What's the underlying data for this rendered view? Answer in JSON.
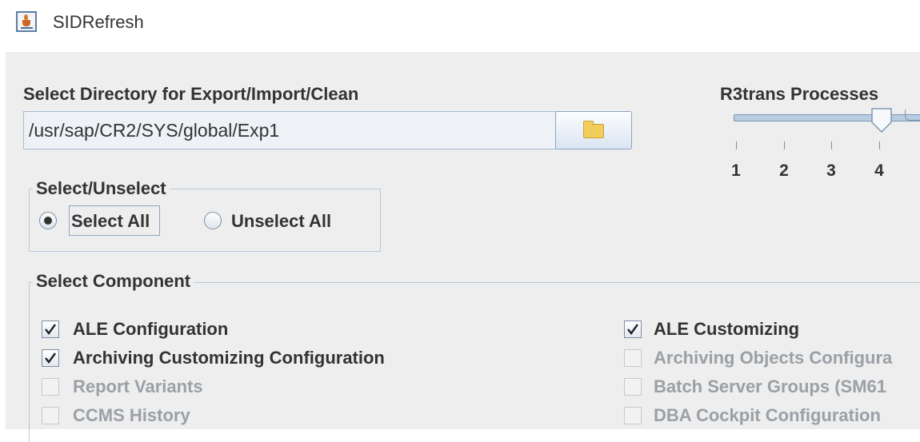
{
  "window": {
    "title": "SIDRefresh",
    "icon": "java-app-icon"
  },
  "directory": {
    "label": "Select Directory for Export/Import/Clean",
    "value": "/usr/sap/CR2/SYS/global/Exp1",
    "browse_icon": "folder-icon"
  },
  "r3trans": {
    "label": "R3trans Processes",
    "ticks": [
      "1",
      "2",
      "3",
      "4"
    ],
    "selected": "4"
  },
  "select_group": {
    "title": "Select/Unselect",
    "select_all": "Select All",
    "unselect_all": "Unselect All",
    "selected": "Select All"
  },
  "components": {
    "title": "Select Component",
    "left": [
      {
        "label": "ALE Configuration",
        "checked": true,
        "enabled": true
      },
      {
        "label": "Archiving Customizing Configuration",
        "checked": true,
        "enabled": true
      },
      {
        "label": "Report Variants",
        "checked": false,
        "enabled": false
      },
      {
        "label": "CCMS History",
        "checked": false,
        "enabled": false
      }
    ],
    "right": [
      {
        "label": "ALE Customizing",
        "checked": true,
        "enabled": true
      },
      {
        "label": "Archiving Objects Configura",
        "checked": false,
        "enabled": false
      },
      {
        "label": "Batch Server Groups (SM61",
        "checked": false,
        "enabled": false
      },
      {
        "label": "DBA Cockpit Configuration",
        "checked": false,
        "enabled": false
      }
    ]
  }
}
